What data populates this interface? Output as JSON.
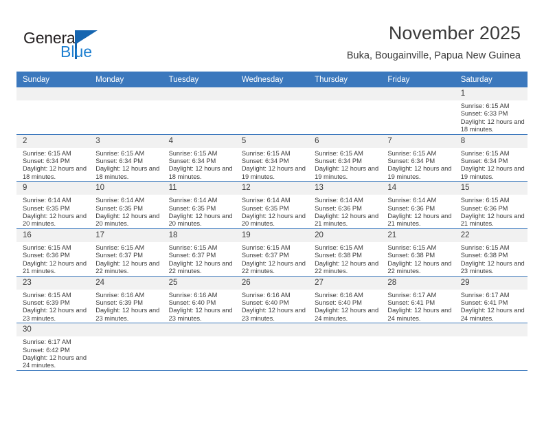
{
  "brand": {
    "name_part1": "General",
    "name_part2": "Blue",
    "accent_color": "#1d7fd0",
    "flag_color": "#1565b0"
  },
  "header": {
    "title": "November 2025",
    "subtitle": "Buka, Bougainville, Papua New Guinea"
  },
  "theme": {
    "header_bar_color": "#3b78bd",
    "day_number_strip_color": "#f1f1f1",
    "text_color": "#3a3a3a"
  },
  "weekday_headers": [
    "Sunday",
    "Monday",
    "Tuesday",
    "Wednesday",
    "Thursday",
    "Friday",
    "Saturday"
  ],
  "labels": {
    "sunrise_prefix": "Sunrise:",
    "sunset_prefix": "Sunset:",
    "daylight_prefix": "Daylight:"
  },
  "weeks": [
    [
      {
        "day": "",
        "empty": true
      },
      {
        "day": "",
        "empty": true
      },
      {
        "day": "",
        "empty": true
      },
      {
        "day": "",
        "empty": true
      },
      {
        "day": "",
        "empty": true
      },
      {
        "day": "",
        "empty": true
      },
      {
        "day": "1",
        "sunrise": "Sunrise: 6:15 AM",
        "sunset": "Sunset: 6:33 PM",
        "daylight": "Daylight: 12 hours and 18 minutes."
      }
    ],
    [
      {
        "day": "2",
        "sunrise": "Sunrise: 6:15 AM",
        "sunset": "Sunset: 6:34 PM",
        "daylight": "Daylight: 12 hours and 18 minutes."
      },
      {
        "day": "3",
        "sunrise": "Sunrise: 6:15 AM",
        "sunset": "Sunset: 6:34 PM",
        "daylight": "Daylight: 12 hours and 18 minutes."
      },
      {
        "day": "4",
        "sunrise": "Sunrise: 6:15 AM",
        "sunset": "Sunset: 6:34 PM",
        "daylight": "Daylight: 12 hours and 18 minutes."
      },
      {
        "day": "5",
        "sunrise": "Sunrise: 6:15 AM",
        "sunset": "Sunset: 6:34 PM",
        "daylight": "Daylight: 12 hours and 19 minutes."
      },
      {
        "day": "6",
        "sunrise": "Sunrise: 6:15 AM",
        "sunset": "Sunset: 6:34 PM",
        "daylight": "Daylight: 12 hours and 19 minutes."
      },
      {
        "day": "7",
        "sunrise": "Sunrise: 6:15 AM",
        "sunset": "Sunset: 6:34 PM",
        "daylight": "Daylight: 12 hours and 19 minutes."
      },
      {
        "day": "8",
        "sunrise": "Sunrise: 6:15 AM",
        "sunset": "Sunset: 6:34 PM",
        "daylight": "Daylight: 12 hours and 19 minutes."
      }
    ],
    [
      {
        "day": "9",
        "sunrise": "Sunrise: 6:14 AM",
        "sunset": "Sunset: 6:35 PM",
        "daylight": "Daylight: 12 hours and 20 minutes."
      },
      {
        "day": "10",
        "sunrise": "Sunrise: 6:14 AM",
        "sunset": "Sunset: 6:35 PM",
        "daylight": "Daylight: 12 hours and 20 minutes."
      },
      {
        "day": "11",
        "sunrise": "Sunrise: 6:14 AM",
        "sunset": "Sunset: 6:35 PM",
        "daylight": "Daylight: 12 hours and 20 minutes."
      },
      {
        "day": "12",
        "sunrise": "Sunrise: 6:14 AM",
        "sunset": "Sunset: 6:35 PM",
        "daylight": "Daylight: 12 hours and 20 minutes."
      },
      {
        "day": "13",
        "sunrise": "Sunrise: 6:14 AM",
        "sunset": "Sunset: 6:36 PM",
        "daylight": "Daylight: 12 hours and 21 minutes."
      },
      {
        "day": "14",
        "sunrise": "Sunrise: 6:14 AM",
        "sunset": "Sunset: 6:36 PM",
        "daylight": "Daylight: 12 hours and 21 minutes."
      },
      {
        "day": "15",
        "sunrise": "Sunrise: 6:15 AM",
        "sunset": "Sunset: 6:36 PM",
        "daylight": "Daylight: 12 hours and 21 minutes."
      }
    ],
    [
      {
        "day": "16",
        "sunrise": "Sunrise: 6:15 AM",
        "sunset": "Sunset: 6:36 PM",
        "daylight": "Daylight: 12 hours and 21 minutes."
      },
      {
        "day": "17",
        "sunrise": "Sunrise: 6:15 AM",
        "sunset": "Sunset: 6:37 PM",
        "daylight": "Daylight: 12 hours and 22 minutes."
      },
      {
        "day": "18",
        "sunrise": "Sunrise: 6:15 AM",
        "sunset": "Sunset: 6:37 PM",
        "daylight": "Daylight: 12 hours and 22 minutes."
      },
      {
        "day": "19",
        "sunrise": "Sunrise: 6:15 AM",
        "sunset": "Sunset: 6:37 PM",
        "daylight": "Daylight: 12 hours and 22 minutes."
      },
      {
        "day": "20",
        "sunrise": "Sunrise: 6:15 AM",
        "sunset": "Sunset: 6:38 PM",
        "daylight": "Daylight: 12 hours and 22 minutes."
      },
      {
        "day": "21",
        "sunrise": "Sunrise: 6:15 AM",
        "sunset": "Sunset: 6:38 PM",
        "daylight": "Daylight: 12 hours and 22 minutes."
      },
      {
        "day": "22",
        "sunrise": "Sunrise: 6:15 AM",
        "sunset": "Sunset: 6:38 PM",
        "daylight": "Daylight: 12 hours and 23 minutes."
      }
    ],
    [
      {
        "day": "23",
        "sunrise": "Sunrise: 6:15 AM",
        "sunset": "Sunset: 6:39 PM",
        "daylight": "Daylight: 12 hours and 23 minutes."
      },
      {
        "day": "24",
        "sunrise": "Sunrise: 6:16 AM",
        "sunset": "Sunset: 6:39 PM",
        "daylight": "Daylight: 12 hours and 23 minutes."
      },
      {
        "day": "25",
        "sunrise": "Sunrise: 6:16 AM",
        "sunset": "Sunset: 6:40 PM",
        "daylight": "Daylight: 12 hours and 23 minutes."
      },
      {
        "day": "26",
        "sunrise": "Sunrise: 6:16 AM",
        "sunset": "Sunset: 6:40 PM",
        "daylight": "Daylight: 12 hours and 23 minutes."
      },
      {
        "day": "27",
        "sunrise": "Sunrise: 6:16 AM",
        "sunset": "Sunset: 6:40 PM",
        "daylight": "Daylight: 12 hours and 24 minutes."
      },
      {
        "day": "28",
        "sunrise": "Sunrise: 6:17 AM",
        "sunset": "Sunset: 6:41 PM",
        "daylight": "Daylight: 12 hours and 24 minutes."
      },
      {
        "day": "29",
        "sunrise": "Sunrise: 6:17 AM",
        "sunset": "Sunset: 6:41 PM",
        "daylight": "Daylight: 12 hours and 24 minutes."
      }
    ],
    [
      {
        "day": "30",
        "sunrise": "Sunrise: 6:17 AM",
        "sunset": "Sunset: 6:42 PM",
        "daylight": "Daylight: 12 hours and 24 minutes."
      },
      {
        "day": "",
        "empty": true
      },
      {
        "day": "",
        "empty": true
      },
      {
        "day": "",
        "empty": true
      },
      {
        "day": "",
        "empty": true
      },
      {
        "day": "",
        "empty": true
      },
      {
        "day": "",
        "empty": true
      }
    ]
  ]
}
